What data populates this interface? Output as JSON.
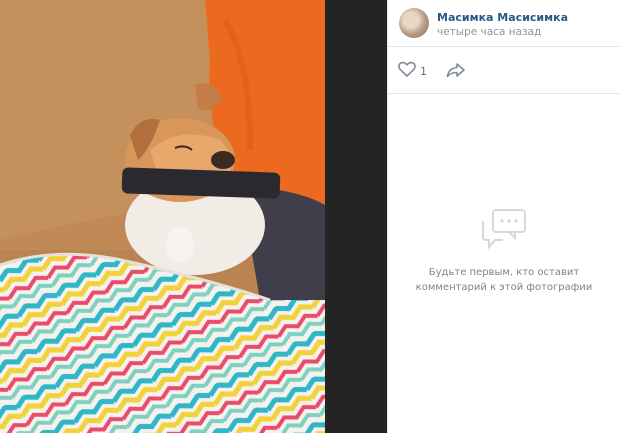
{
  "post": {
    "author": "Масимка Масисимка",
    "time": "четыре часа назад"
  },
  "actions": {
    "like_count": "1"
  },
  "comments": {
    "empty_line1": "Будьте первым, кто оставит",
    "empty_line2": "комментарий к этой фотографии"
  },
  "icons": {
    "like": "heart-icon",
    "share": "share-arrow-icon",
    "comments": "comments-bubble-icon"
  },
  "colors": {
    "link": "#2a5885",
    "muted": "#939393",
    "icon": "#828a99",
    "viewer_bg": "#242424"
  }
}
